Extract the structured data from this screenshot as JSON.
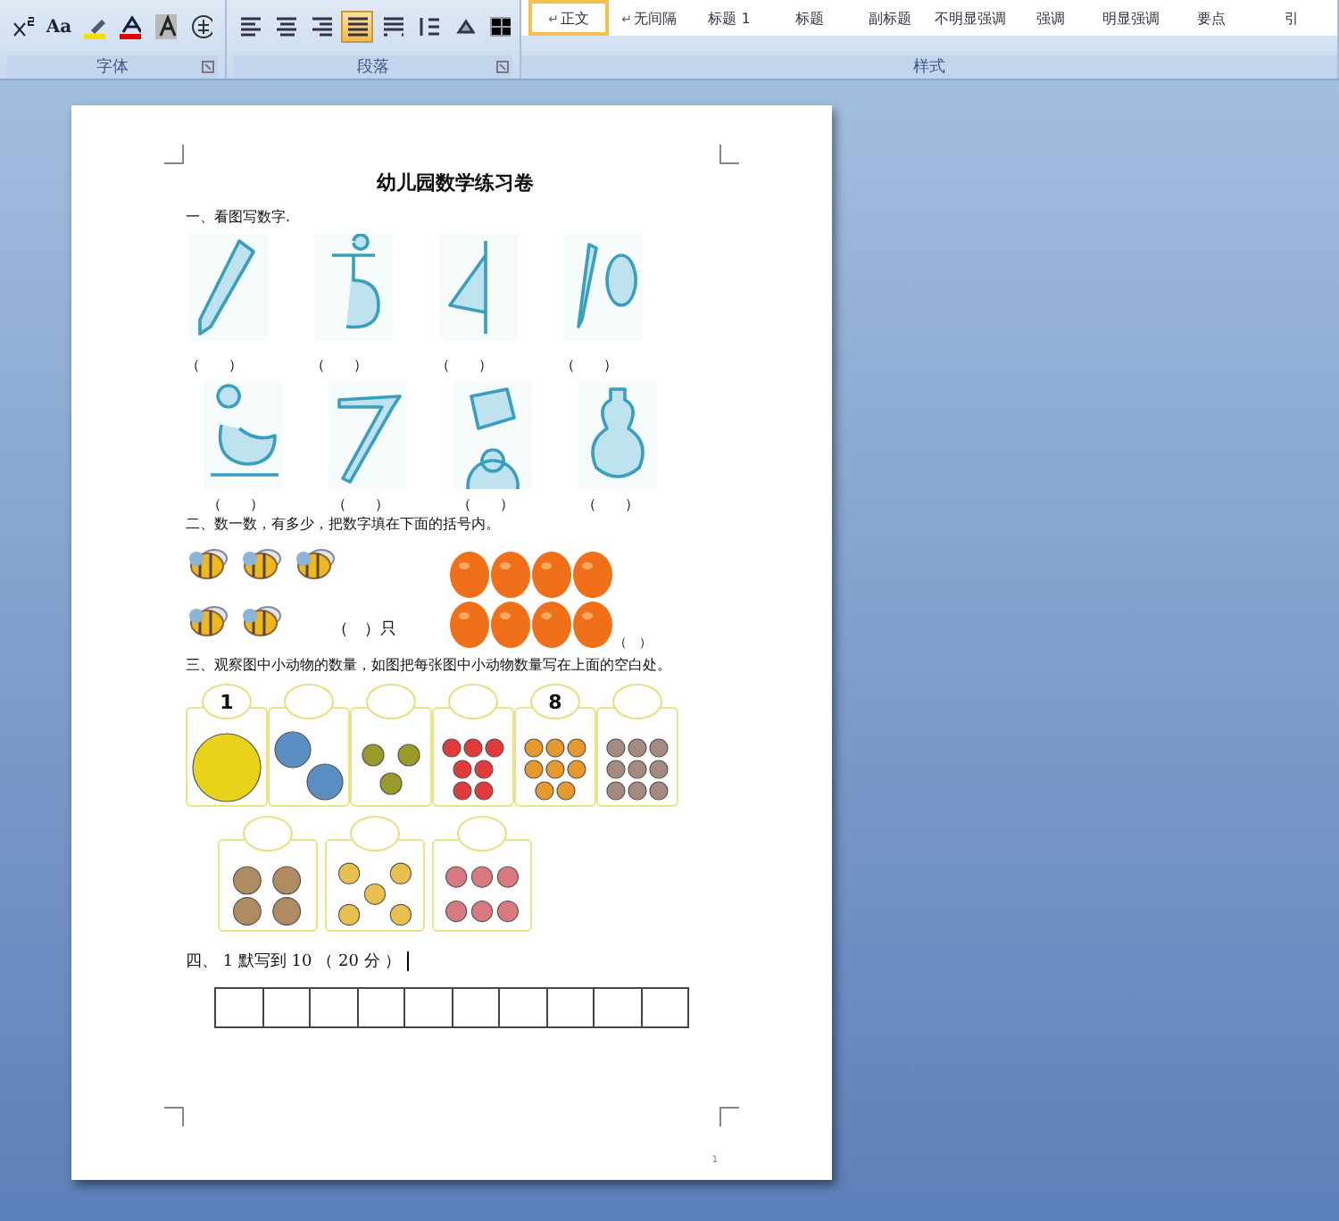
{
  "ribbon": {
    "groups": [
      {
        "label": "字体"
      },
      {
        "label": "段落"
      },
      {
        "label": "样式"
      }
    ],
    "font_buttons": [
      {
        "kind": "superscript",
        "selected": false
      },
      {
        "kind": "case",
        "label": "Aa",
        "selected": false
      },
      {
        "kind": "highlight",
        "selected": false
      },
      {
        "kind": "font-color",
        "selected": false
      },
      {
        "kind": "char-shading",
        "selected": false
      },
      {
        "kind": "enclose",
        "selected": false
      }
    ],
    "paragraph_buttons": [
      {
        "kind": "align-left",
        "selected": false
      },
      {
        "kind": "align-center",
        "selected": false
      },
      {
        "kind": "align-right",
        "selected": false
      },
      {
        "kind": "justify",
        "selected": true
      },
      {
        "kind": "distribute",
        "selected": false
      },
      {
        "kind": "line-spacing",
        "selected": false
      },
      {
        "kind": "shading",
        "selected": false
      },
      {
        "kind": "border",
        "selected": false
      }
    ],
    "styles": [
      {
        "label": "正文",
        "marker": "↵",
        "selected": true
      },
      {
        "label": "无间隔",
        "marker": "↵",
        "selected": false
      },
      {
        "label": "标题 1",
        "selected": false
      },
      {
        "label": "标题",
        "selected": false
      },
      {
        "label": "副标题",
        "selected": false
      },
      {
        "label": "不明显强调",
        "selected": false
      },
      {
        "label": "强调",
        "selected": false
      },
      {
        "label": "明显强调",
        "selected": false
      },
      {
        "label": "要点",
        "selected": false
      },
      {
        "label": "引",
        "selected": false
      }
    ]
  },
  "document": {
    "title": "幼儿园数学练习卷",
    "section_1": {
      "heading": "一、看图写数字.",
      "rows": [
        [
          {
            "kind": "pencil",
            "blank": "（　　）"
          },
          {
            "kind": "hook",
            "blank": "（　　）"
          },
          {
            "kind": "flag",
            "blank": "（　　）"
          },
          {
            "kind": "pencil-egg",
            "blank": "（　　）"
          }
        ],
        [
          {
            "kind": "duck",
            "blank": "（　　）"
          },
          {
            "kind": "sickle",
            "blank": "（　　）"
          },
          {
            "kind": "whistle",
            "blank": "（　　）"
          },
          {
            "kind": "gourd",
            "blank": "（　　）"
          }
        ]
      ]
    },
    "section_2": {
      "heading": "二、数一数，有多少，把数字填在下面的括号内。",
      "bees_blank": "（　）只",
      "oranges_blank": "（　）"
    },
    "section_3": {
      "heading": "三、观察图中小动物的数量，如图把每张图中小动物数量写在上面的空白处。",
      "rows": [
        [
          {
            "kind": "snake",
            "written": "1"
          },
          {
            "kind": "bird"
          },
          {
            "kind": "frog"
          },
          {
            "kind": "heart"
          },
          {
            "kind": "cookie",
            "written": "8"
          },
          {
            "kind": "shell"
          }
        ],
        [
          {
            "kind": "bag"
          },
          {
            "kind": "vest"
          },
          {
            "kind": "sock"
          }
        ]
      ]
    },
    "section_4": {
      "heading": "四、 1 默写到 10 （ 20 分 ）"
    },
    "page_number": "1"
  }
}
